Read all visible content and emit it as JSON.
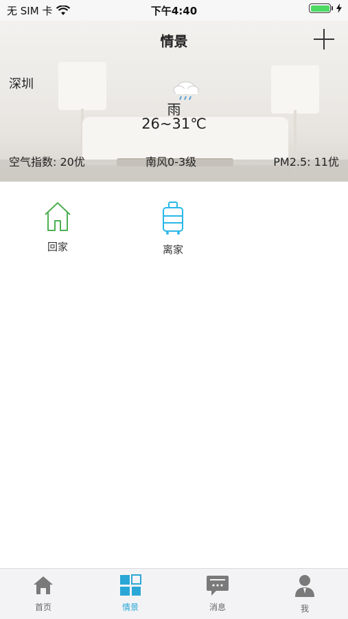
{
  "status_bar": {
    "carrier": "无 SIM 卡",
    "time": "下午4:40",
    "battery_level": 1.0
  },
  "header": {
    "title": "情景",
    "add_icon": "plus-icon"
  },
  "weather": {
    "city": "深圳",
    "icon": "cloud-rain-icon",
    "description": "雨",
    "temperature": "26~31℃",
    "air_quality": "空气指数: 20优",
    "wind": "南风0-3级",
    "pm25": "PM2.5: 11优"
  },
  "scenes": [
    {
      "label": "回家",
      "icon": "home-icon",
      "color": "#4caf50"
    },
    {
      "label": "离家",
      "icon": "suitcase-icon",
      "color": "#29b6e8"
    }
  ],
  "tabs": [
    {
      "label": "首页",
      "icon": "home-icon",
      "active": false
    },
    {
      "label": "情景",
      "icon": "grid-icon",
      "active": true
    },
    {
      "label": "消息",
      "icon": "message-icon",
      "active": false
    },
    {
      "label": "我",
      "icon": "user-icon",
      "active": false
    }
  ],
  "colors": {
    "accent": "#2aa7d6",
    "tab_inactive": "#7a7a7a",
    "battery": "#4cd964"
  }
}
